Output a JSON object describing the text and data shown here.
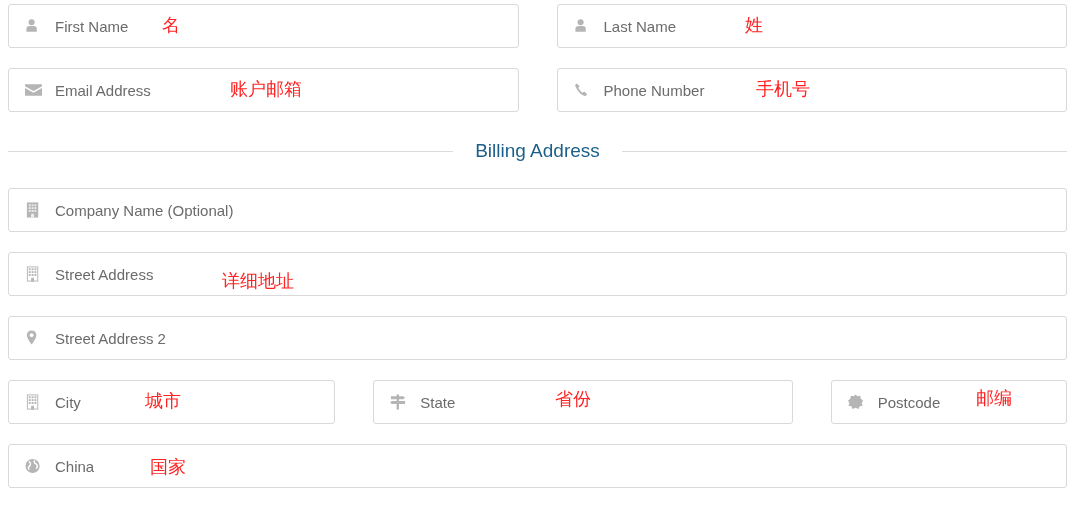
{
  "contact_rows": [
    [
      {
        "placeholder": "First Name",
        "annotation": "名"
      },
      {
        "placeholder": "Last Name",
        "annotation": "姓"
      }
    ],
    [
      {
        "placeholder": "Email Address",
        "annotation": "账户邮箱"
      },
      {
        "placeholder": "Phone Number",
        "annotation": "手机号"
      }
    ]
  ],
  "section_title": "Billing Address",
  "billing_rows": [
    [
      {
        "placeholder": "Company Name (Optional)"
      }
    ],
    [
      {
        "placeholder": "Street Address",
        "annotation": "详细地址"
      }
    ],
    [
      {
        "placeholder": "Street Address 2"
      }
    ],
    [
      {
        "placeholder": "City",
        "annotation": "城市"
      },
      {
        "placeholder": "State",
        "annotation": "省份"
      },
      {
        "placeholder": "Postcode",
        "annotation": "邮编"
      }
    ],
    [
      {
        "placeholder": "China",
        "annotation": "国家"
      }
    ]
  ]
}
